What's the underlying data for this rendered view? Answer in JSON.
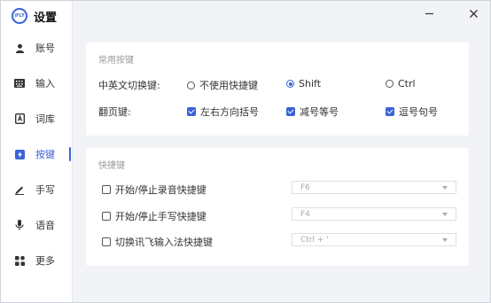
{
  "app": {
    "logo_text": "iFLY",
    "title": "设置"
  },
  "window_controls": {
    "minimize_icon": "minimize-icon",
    "close_icon": "close-icon"
  },
  "sidebar": {
    "items": [
      {
        "label": "账号",
        "icon": "user-icon",
        "active": false
      },
      {
        "label": "输入",
        "icon": "keyboard-icon",
        "active": false
      },
      {
        "label": "词库",
        "icon": "lexicon-icon",
        "active": false
      },
      {
        "label": "按键",
        "icon": "lightning-key-icon",
        "active": true
      },
      {
        "label": "手写",
        "icon": "pen-icon",
        "active": false
      },
      {
        "label": "语音",
        "icon": "microphone-icon",
        "active": false
      },
      {
        "label": "更多",
        "icon": "grid-more-icon",
        "active": false
      }
    ],
    "accent_color": "#3b63d6"
  },
  "common_keys": {
    "section_title": "常用按键",
    "cn_en_switch": {
      "label": "中英文切换键:",
      "options": [
        {
          "label": "不使用快捷键",
          "selected": false
        },
        {
          "label": "Shift",
          "selected": true
        },
        {
          "label": "Ctrl",
          "selected": false
        }
      ]
    },
    "page_turn": {
      "label": "翻页键:",
      "options": [
        {
          "label": "左右方向括号",
          "checked": true
        },
        {
          "label": "减号等号",
          "checked": true
        },
        {
          "label": "逗号句号",
          "checked": true
        }
      ]
    }
  },
  "shortcuts": {
    "section_title": "快捷键",
    "items": [
      {
        "label": "开始/停止录音快捷键",
        "checked": false,
        "value": "F6"
      },
      {
        "label": "开始/停止手写快捷键",
        "checked": false,
        "value": "F4"
      },
      {
        "label": "切换讯飞输入法快捷键",
        "checked": false,
        "value": "Ctrl + '"
      }
    ]
  }
}
